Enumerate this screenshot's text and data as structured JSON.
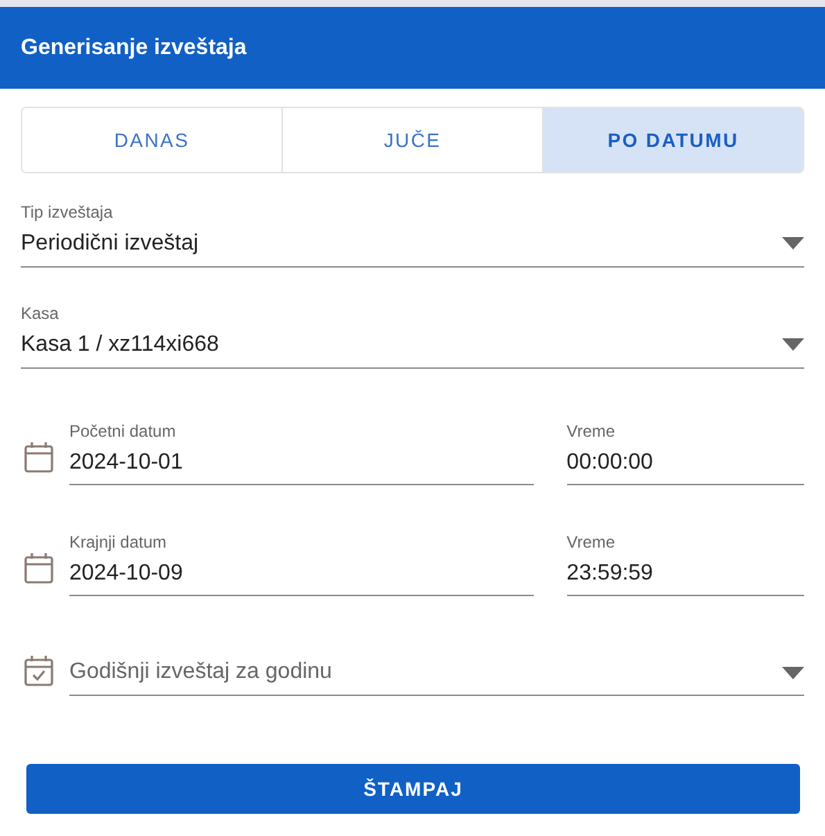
{
  "header": {
    "title": "Generisanje izveštaja"
  },
  "tabs": [
    {
      "label": "DANAS",
      "selected": false
    },
    {
      "label": "JUČE",
      "selected": false
    },
    {
      "label": "PO DATUMU",
      "selected": true
    }
  ],
  "selects": [
    {
      "label": "Tip izveštaja",
      "value": "Periodični izveštaj"
    },
    {
      "label": "Kasa",
      "value": "Kasa 1 / xz114xi668"
    }
  ],
  "date_ranges": [
    {
      "date_label": "Početni datum",
      "date": "2024-10-01",
      "time_label": "Vreme",
      "time": "00:00:00"
    },
    {
      "date_label": "Krajnji datum",
      "date": "2024-10-09",
      "time_label": "Vreme",
      "time": "23:59:59"
    }
  ],
  "yearly": {
    "placeholder": "Godišnji izveštaj za godinu"
  },
  "print_button": "ŠTAMPAJ"
}
